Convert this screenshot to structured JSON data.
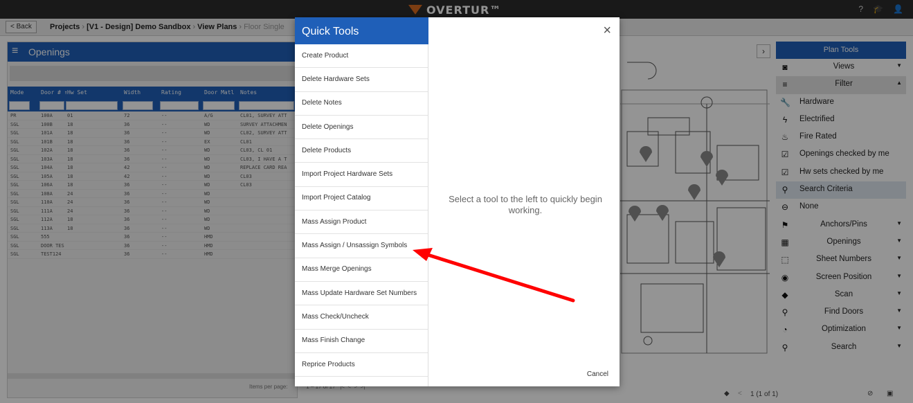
{
  "app": {
    "logo_text": "OVERTUR™"
  },
  "topbar": {
    "icons": [
      "help-icon",
      "graduation-cap-icon",
      "user-icon"
    ]
  },
  "breadcrumb": {
    "back": "< Back",
    "projects": "Projects",
    "project": "[V1 - Design] Demo Sandbox",
    "view_plans": "View Plans",
    "floor": "Floor Single"
  },
  "openings": {
    "title": "Openings",
    "columns": [
      "Mode",
      "Door # ↑",
      "Hw Set",
      "Width",
      "Rating",
      "Door Matl",
      "Notes"
    ],
    "rows": [
      [
        "PR",
        "100A",
        "01",
        "72",
        "--",
        "A/G",
        "CL01, SURVEY ATT"
      ],
      [
        "SGL",
        "100B",
        "18",
        "36",
        "--",
        "WD",
        "SURVEY ATTACHMEN"
      ],
      [
        "SGL",
        "101A",
        "18",
        "36",
        "--",
        "WD",
        "CL02, SURVEY ATT"
      ],
      [
        "SGL",
        "101B",
        "18",
        "36",
        "--",
        "EX",
        "CL01"
      ],
      [
        "SGL",
        "102A",
        "18",
        "36",
        "--",
        "WD",
        "CL03, CL 01"
      ],
      [
        "SGL",
        "103A",
        "18",
        "36",
        "--",
        "WD",
        "CL03, I HAVE A T"
      ],
      [
        "SGL",
        "104A",
        "18",
        "42",
        "--",
        "WD",
        "REPLACE CARD REA"
      ],
      [
        "SGL",
        "105A",
        "18",
        "42",
        "--",
        "WD",
        "CL03"
      ],
      [
        "SGL",
        "106A",
        "18",
        "36",
        "--",
        "WD",
        "CL03"
      ],
      [
        "SGL",
        "108A",
        "24",
        "36",
        "--",
        "WD",
        ""
      ],
      [
        "SGL",
        "110A",
        "24",
        "36",
        "--",
        "WD",
        ""
      ],
      [
        "SGL",
        "111A",
        "24",
        "36",
        "--",
        "WD",
        ""
      ],
      [
        "SGL",
        "112A",
        "18",
        "36",
        "--",
        "WD",
        ""
      ],
      [
        "SGL",
        "113A",
        "18",
        "36",
        "--",
        "WD",
        ""
      ],
      [
        "SGL",
        "555",
        "",
        "36",
        "--",
        "HMD",
        ""
      ],
      [
        "SGL",
        "DOOR TES",
        "",
        "36",
        "--",
        "HMD",
        ""
      ],
      [
        "SGL",
        "TEST124",
        "",
        "36",
        "--",
        "HMD",
        ""
      ]
    ],
    "pager": {
      "items_per_page": "Items per page:",
      "range": "1 – 17 of 17"
    }
  },
  "quick_tools": {
    "title": "Quick Tools",
    "items": [
      "Create Product",
      "Delete Hardware Sets",
      "Delete Notes",
      "Delete Openings",
      "Delete Products",
      "Import Project Hardware Sets",
      "Import Project Catalog",
      "Mass Assign Product",
      "Mass Assign / Unsassign Symbols",
      "Mass Merge Openings",
      "Mass Update Hardware Set Numbers",
      "Mass Check/Uncheck",
      "Mass Finish Change",
      "Reprice Products"
    ],
    "hint": "Select a tool to the left to quickly begin working.",
    "cancel": "Cancel",
    "close": "×"
  },
  "plan_tools": {
    "title": "Plan Tools",
    "rows": [
      {
        "label": "Views",
        "icon": "views-icon",
        "glyph": "◙",
        "kind": "section",
        "chev": "▼"
      },
      {
        "label": "Filter",
        "icon": "filter-icon",
        "glyph": "≡",
        "kind": "section",
        "chev": "▲",
        "shade": true
      },
      {
        "label": "Hardware",
        "icon": "wrench-icon",
        "glyph": "🔧",
        "kind": "item"
      },
      {
        "label": "Electrified",
        "icon": "bolt-icon",
        "glyph": "ϟ",
        "kind": "item"
      },
      {
        "label": "Fire Rated",
        "icon": "fire-icon",
        "glyph": "♨",
        "kind": "item"
      },
      {
        "label": "Openings checked by me",
        "icon": "checkbox-icon",
        "glyph": "☑",
        "kind": "item"
      },
      {
        "label": "Hw sets checked by me",
        "icon": "checkbox-icon",
        "glyph": "☑",
        "kind": "item"
      },
      {
        "label": "Search Criteria",
        "icon": "search-icon",
        "glyph": "⚲",
        "kind": "item",
        "sel": true
      },
      {
        "label": "None",
        "icon": "minus-circle-icon",
        "glyph": "⊖",
        "kind": "item"
      },
      {
        "label": "Anchors/Pins",
        "icon": "pin-icon",
        "glyph": "⚑",
        "kind": "section",
        "chev": "▼"
      },
      {
        "label": "Openings",
        "icon": "grid-icon",
        "glyph": "▦",
        "kind": "section",
        "chev": "▼"
      },
      {
        "label": "Sheet Numbers",
        "icon": "sheet-icon",
        "glyph": "⬚",
        "kind": "section",
        "chev": "▼"
      },
      {
        "label": "Screen Position",
        "icon": "target-icon",
        "glyph": "◉",
        "kind": "section",
        "chev": "▼"
      },
      {
        "label": "Scan",
        "icon": "scan-icon",
        "glyph": "◆",
        "kind": "section",
        "chev": "▼"
      },
      {
        "label": "Find Doors",
        "icon": "search-icon",
        "glyph": "⚲",
        "kind": "section",
        "chev": "▼"
      },
      {
        "label": "Optimization",
        "icon": "gauge-icon",
        "glyph": "◔",
        "kind": "section",
        "chev": "▼"
      },
      {
        "label": "Search",
        "icon": "search-icon",
        "glyph": "⚲",
        "kind": "section",
        "chev": "▼"
      }
    ]
  },
  "plan_footer": {
    "page": "1 (1 of 1)"
  },
  "colors": {
    "brand_blue": "#1f5fb8",
    "arrow_red": "#ff0000",
    "logo_orange": "#d66a1f"
  }
}
